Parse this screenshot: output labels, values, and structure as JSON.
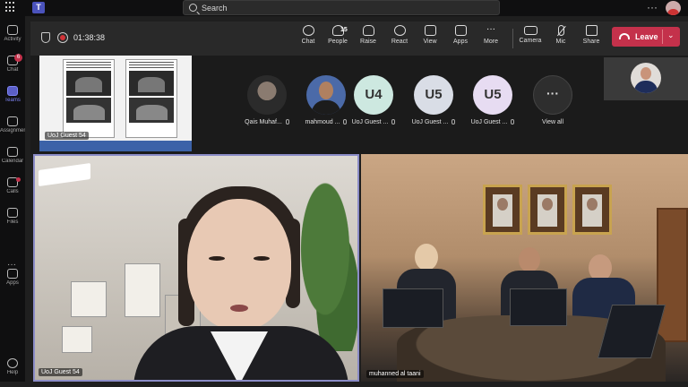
{
  "search": {
    "label": "Search"
  },
  "topbar": {
    "more": "···"
  },
  "rail": {
    "items": [
      {
        "label": "Activity"
      },
      {
        "label": "Chat",
        "badge": "6"
      },
      {
        "label": "Teams"
      },
      {
        "label": "Assignments"
      },
      {
        "label": "Calendar"
      },
      {
        "label": "Calls"
      },
      {
        "label": "Files"
      },
      {
        "label": "Apps"
      },
      {
        "label": "Help"
      }
    ],
    "more": "···"
  },
  "meeting": {
    "timer": "01:38:38",
    "controls": {
      "chat": "Chat",
      "people": "People",
      "people_count": "15",
      "raise": "Raise",
      "react": "React",
      "view": "View",
      "apps": "Apps",
      "more": "More",
      "camera": "Camera",
      "mic": "Mic",
      "share": "Share"
    },
    "leave": "Leave"
  },
  "strip": {
    "shared_by": "UoJ Guest 54",
    "participants": [
      {
        "name": "Qais Muhaf..."
      },
      {
        "name": "mahmoud ..."
      },
      {
        "name": "UoJ Guest ...",
        "initials": "U4"
      },
      {
        "name": "UoJ Guest ...",
        "initials": "U5"
      },
      {
        "name": "UoJ Guest ...",
        "initials": "U5"
      },
      {
        "name": "View all",
        "initials": "···"
      }
    ]
  },
  "tiles": {
    "left_name": "UoJ Guest 54",
    "right_name": "muhanned al taani"
  },
  "colors": {
    "accent": "#5b5fc7",
    "leave": "#c4314b",
    "speaker_border": "#8b8cc7"
  }
}
